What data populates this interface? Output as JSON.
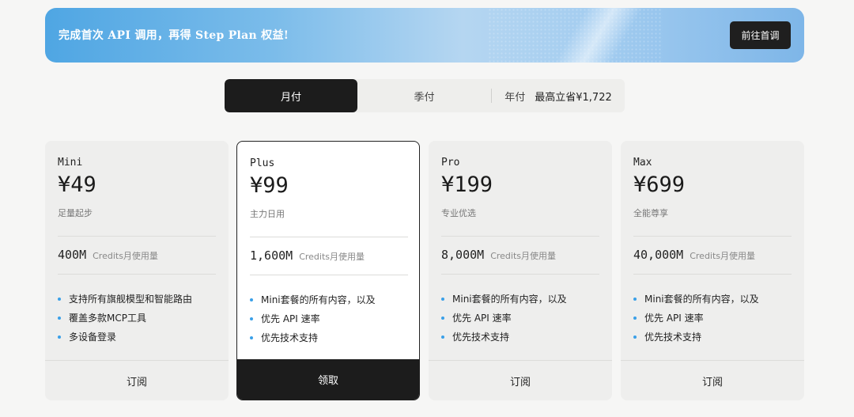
{
  "banner": {
    "text": "完成首次 API 调用，再得 Step Plan 权益!",
    "button_label": "前往首调"
  },
  "billing_tabs": {
    "monthly": "月付",
    "quarterly": "季付",
    "yearly": "年付",
    "yearly_badge": "最高立省¥1,722",
    "active": "monthly"
  },
  "plans": [
    {
      "name": "Mini",
      "price": "¥49",
      "tagline": "足量起步",
      "credits": "400M",
      "credits_label": "Credits月使用量",
      "features": [
        "支持所有旗舰模型和智能路由",
        "覆盖多款MCP工具",
        "多设备登录"
      ],
      "button_label": "订阅"
    },
    {
      "name": "Plus",
      "price": "¥99",
      "tagline": "主力日用",
      "credits": "1,600M",
      "credits_label": "Credits月使用量",
      "features": [
        "Mini套餐的所有内容，以及",
        "优先 API 速率",
        "优先技术支持"
      ],
      "button_label": "领取"
    },
    {
      "name": "Pro",
      "price": "¥199",
      "tagline": "专业优选",
      "credits": "8,000M",
      "credits_label": "Credits月使用量",
      "features": [
        "Mini套餐的所有内容，以及",
        "优先 API 速率",
        "优先技术支持"
      ],
      "button_label": "订阅"
    },
    {
      "name": "Max",
      "price": "¥699",
      "tagline": "全能尊享",
      "credits": "40,000M",
      "credits_label": "Credits月使用量",
      "features": [
        "Mini套餐的所有内容，以及",
        "优先 API 速率",
        "优先技术支持"
      ],
      "button_label": "订阅"
    }
  ],
  "colors": {
    "accent_dot": "#3aa0e8",
    "dark": "#1c1c1c",
    "banner_start": "#4fa6e3"
  }
}
